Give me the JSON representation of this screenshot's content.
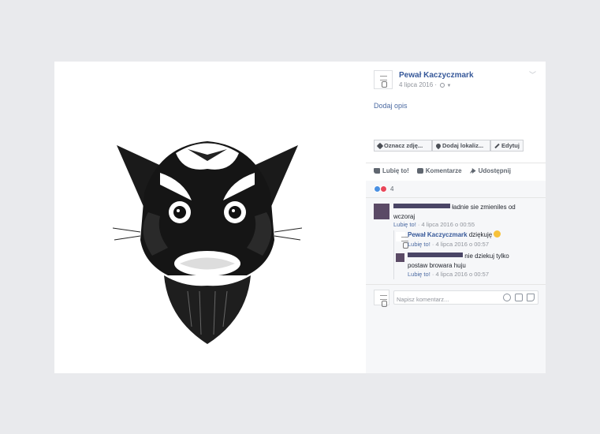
{
  "post": {
    "author": "Pewał Kaczyczmark",
    "date": "4 lipca 2016",
    "date_separator": "·",
    "description_placeholder": "Dodaj opis",
    "buttons": {
      "tag": "Oznacz zdję...",
      "location": "Dodaj lokaliz...",
      "edit": "Edytuj"
    },
    "actions": {
      "like": "Lubię to!",
      "comment": "Komentarze",
      "share": "Udostępnij"
    },
    "reactions_count": "4"
  },
  "comments": [
    {
      "text": "ładnie sie zmieniles od wczoraj",
      "like": "Lubię to!",
      "time": "4 lipca 2016 o 00:55",
      "replies": [
        {
          "author": "Pewał Kaczyczmark",
          "text": "dziękuję",
          "like": "Lubię to!",
          "time": "4 lipca 2016 o 00:57"
        },
        {
          "text": "nie dziekuj tylko postaw browara huju",
          "like": "Lubię to!",
          "time": "4 lipca 2016 o 00:57"
        }
      ]
    }
  ],
  "composer": {
    "placeholder": "Napisz komentarz..."
  },
  "meta_separator": " · ",
  "colors": {
    "link": "#365899",
    "background": "#e9eaed",
    "comment_bg": "#f6f7f9"
  }
}
